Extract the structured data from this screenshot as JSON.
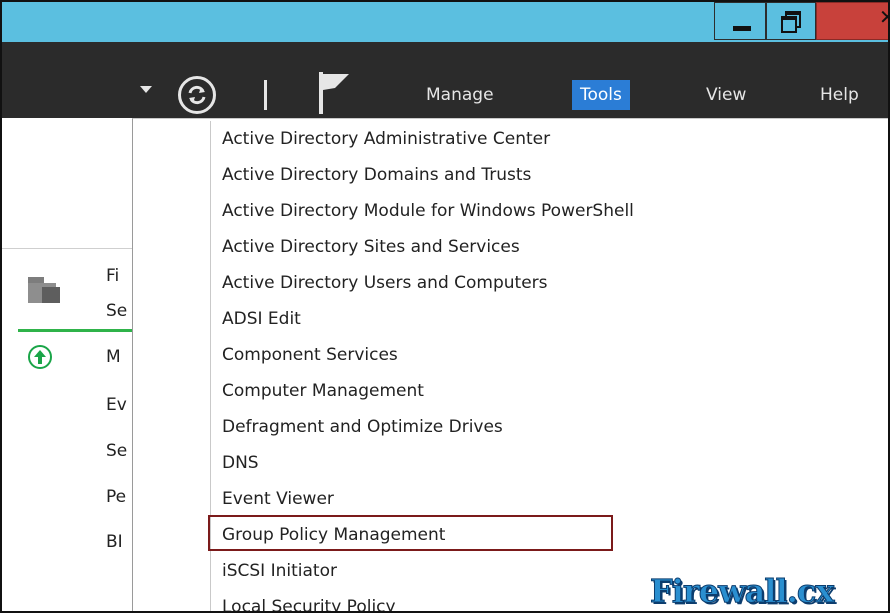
{
  "menubar": {
    "items": [
      {
        "label": "Manage"
      },
      {
        "label": "Tools"
      },
      {
        "label": "View"
      },
      {
        "label": "Help"
      }
    ],
    "active": "Tools"
  },
  "sidebar": {
    "lines": [
      "Fi",
      "Se",
      "M",
      "Ev",
      "Se",
      "Pe",
      "BI"
    ]
  },
  "tools_menu": {
    "items": [
      "Active Directory Administrative Center",
      "Active Directory Domains and Trusts",
      "Active Directory Module for Windows PowerShell",
      "Active Directory Sites and Services",
      "Active Directory Users and Computers",
      "ADSI Edit",
      "Component Services",
      "Computer Management",
      "Defragment and Optimize Drives",
      "DNS",
      "Event Viewer",
      "Group Policy Management",
      "iSCSI Initiator",
      "Local Security Policy"
    ],
    "highlighted": "Group Policy Management"
  },
  "watermark": "Firewall.cx",
  "colors": {
    "titlebar": "#5bbfe0",
    "toolbar": "#2b2b2b",
    "active_menu": "#2b7dd6",
    "highlight_border": "#7b1a1a",
    "green": "#2fb34a"
  },
  "icons": [
    "minimize-icon",
    "restore-icon",
    "close-icon",
    "dropdown-arrow-icon",
    "refresh-icon",
    "flag-icon",
    "folder-icon",
    "upload-icon"
  ]
}
